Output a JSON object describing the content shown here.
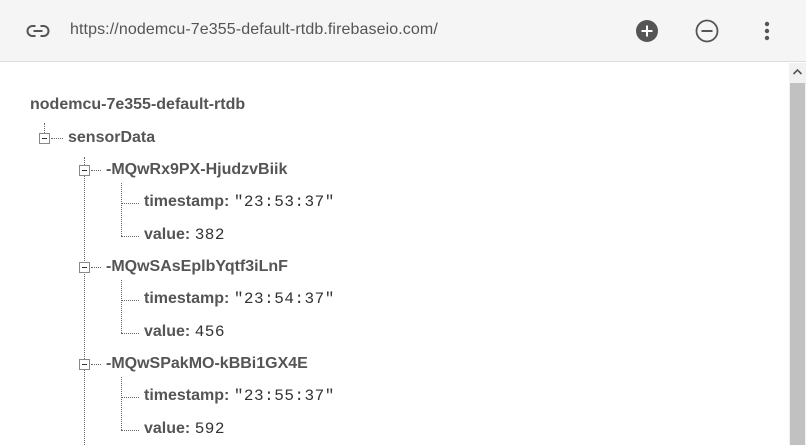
{
  "header": {
    "url": "https://nodemcu-7e355-default-rtdb.firebaseio.com/",
    "icons": {
      "link": "link-icon",
      "add": "add-circle-icon",
      "remove": "remove-circle-icon",
      "more": "more-vert-icon"
    }
  },
  "tree": {
    "root": "nodemcu-7e355-default-rtdb",
    "sensorData": {
      "label": "sensorData",
      "entries": [
        {
          "key": "-MQwRx9PX-HjudzvBiik",
          "timestamp_label": "timestamp:",
          "timestamp_value": "\"23:53:37\"",
          "value_label": "value:",
          "value_value": "382"
        },
        {
          "key": "-MQwSAsEplbYqtf3iLnF",
          "timestamp_label": "timestamp:",
          "timestamp_value": "\"23:54:37\"",
          "value_label": "value:",
          "value_value": "456"
        },
        {
          "key": "-MQwSPakMO-kBBi1GX4E",
          "timestamp_label": "timestamp:",
          "timestamp_value": "\"23:55:37\"",
          "value_label": "value:",
          "value_value": "592"
        }
      ]
    }
  },
  "colors": {
    "header_bg": "#f5f5f5",
    "icon_dark": "#555555",
    "scroll_thumb": "#c1c1c1"
  }
}
